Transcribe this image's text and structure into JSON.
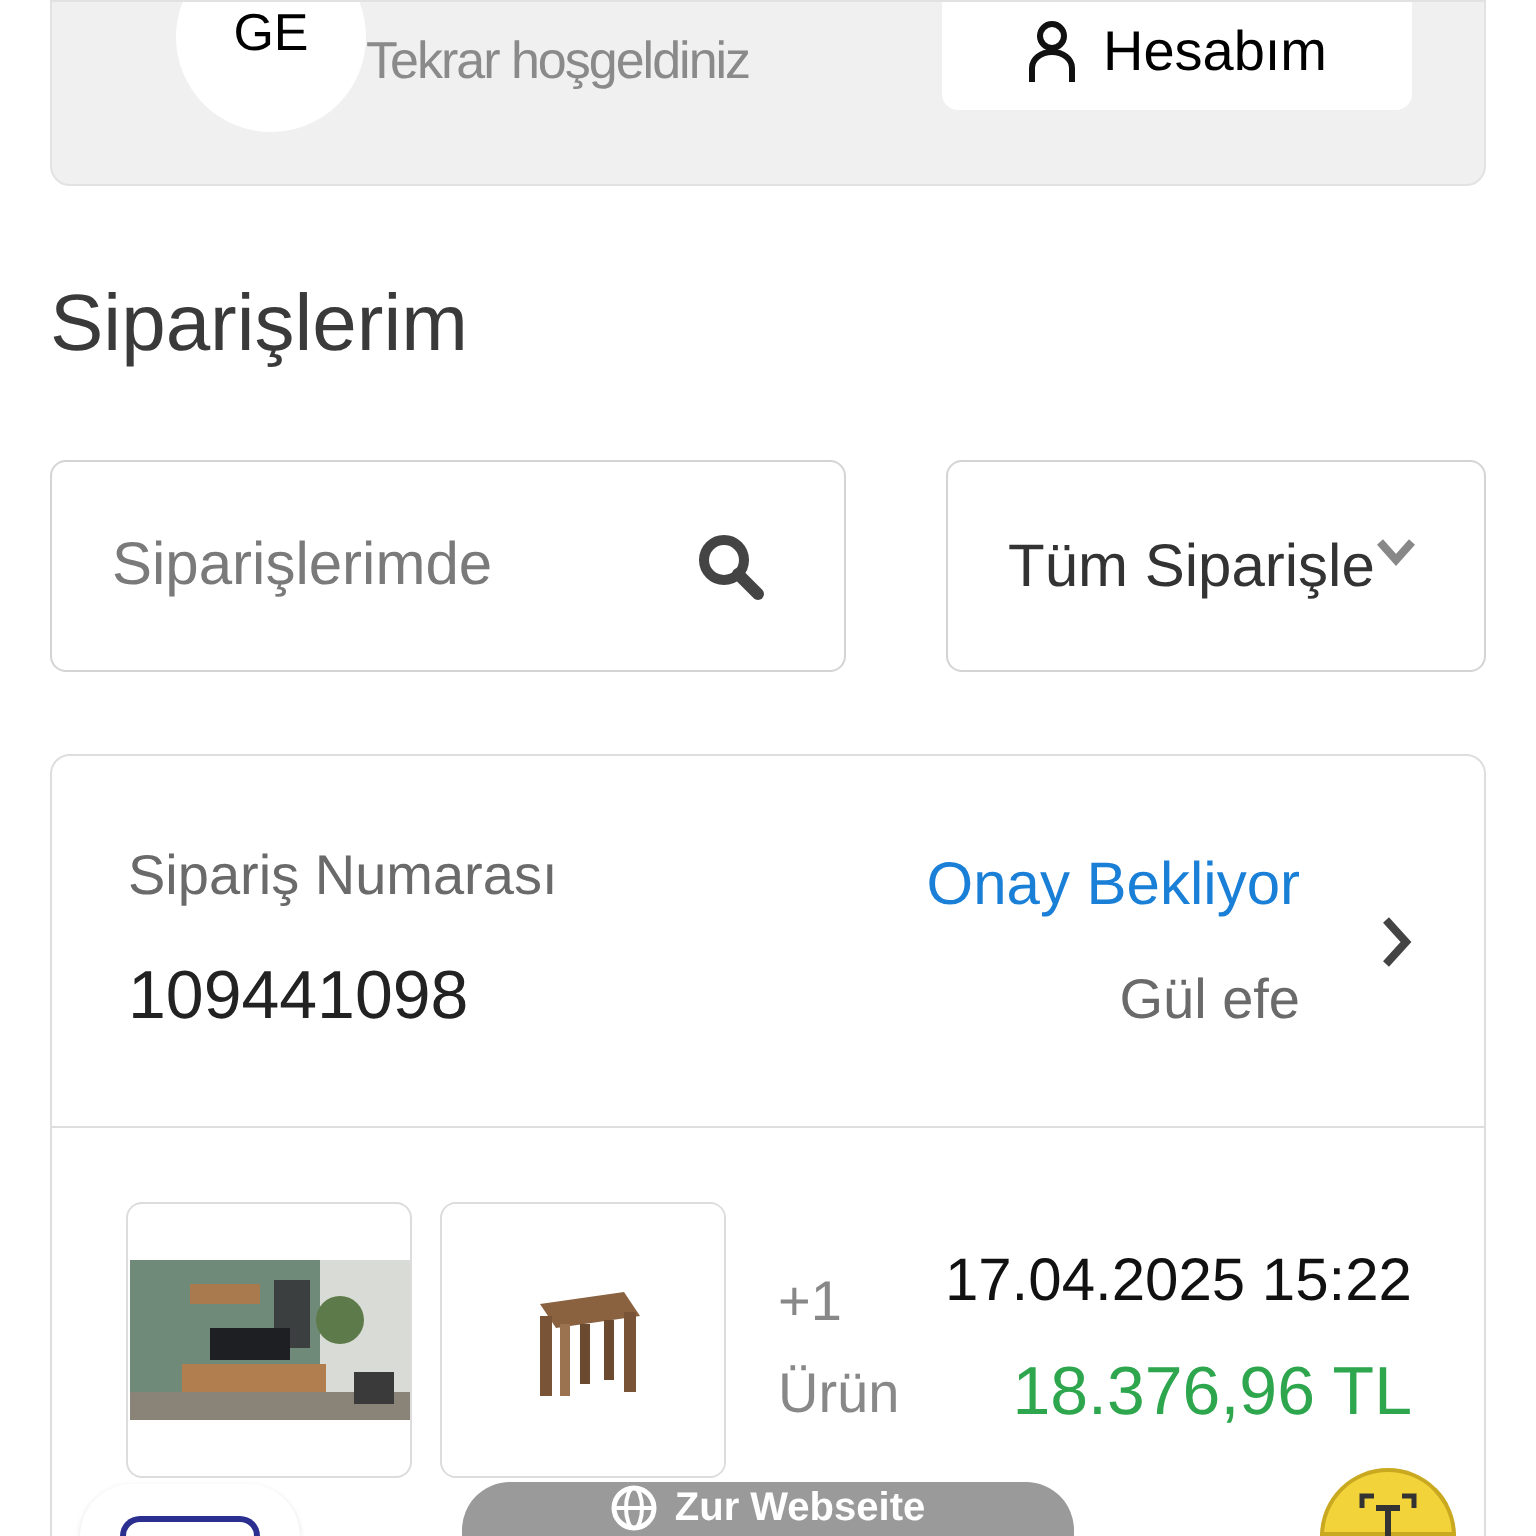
{
  "profile": {
    "initials": "GE",
    "greeting": "Tekrar hoşgeldiniz",
    "account_button": "Hesabım"
  },
  "page_title": "Siparişlerim",
  "search": {
    "placeholder": "Siparişlerimde"
  },
  "filter": {
    "value": "Tüm Siparişle"
  },
  "order": {
    "number_label": "Sipariş Numarası",
    "number": "109441098",
    "status": "Onay Bekliyor",
    "recipient": "Gül efe",
    "extra_count": "+1",
    "extra_label": "Ürün",
    "date": "17.04.2025 15:22",
    "total": "18.376,96 TL"
  },
  "floating_button": "Zur Webseite"
}
